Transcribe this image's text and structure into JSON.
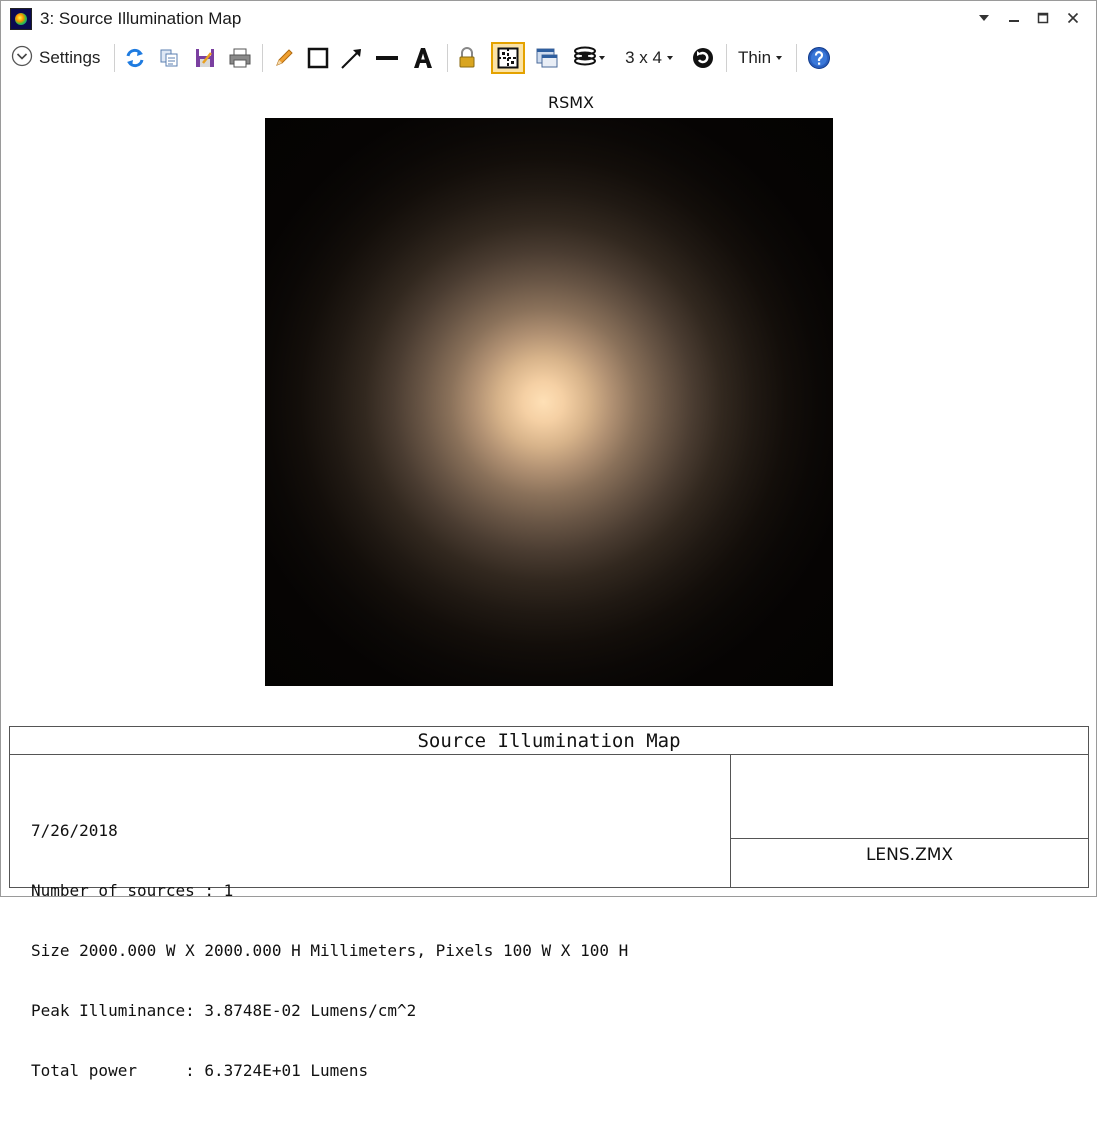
{
  "window": {
    "title": "3: Source Illumination Map"
  },
  "toolbar": {
    "settings_label": "Settings",
    "layout_label": "3 x 4",
    "line_width_label": "Thin",
    "icons": [
      "chevron-down-circle-icon",
      "refresh-icon",
      "copy-icon",
      "save-icon",
      "print-icon",
      "pencil-icon",
      "rectangle-icon",
      "arrow-line-icon",
      "line-icon",
      "text-icon",
      "lock-icon",
      "grid-toggle-icon",
      "window-icon",
      "layers-icon",
      "rotate-icon",
      "help-icon"
    ]
  },
  "plot": {
    "title": "RSMX"
  },
  "info_panel": {
    "title": "Source Illumination Map",
    "lines": [
      "7/26/2018",
      "Number of sources : 1",
      "Size 2000.000 W X 2000.000 H Millimeters, Pixels 100 W X 100 H",
      "Peak Illuminance: 3.8748E-02 Lumens/cm^2",
      "Total power     : 6.3724E+01 Lumens"
    ],
    "file_name": "LENS.ZMX"
  }
}
